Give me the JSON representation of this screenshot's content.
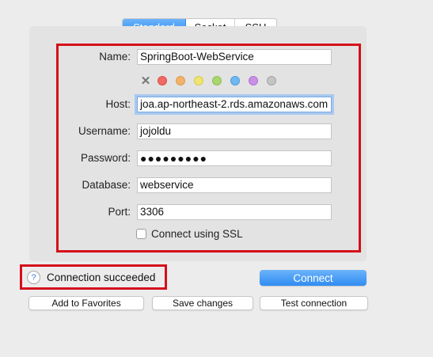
{
  "tabs": [
    {
      "label": "Standard",
      "active": true
    },
    {
      "label": "Socket",
      "active": false
    },
    {
      "label": "SSH",
      "active": false
    }
  ],
  "form": {
    "name": {
      "label": "Name:",
      "value": "SpringBoot-WebService"
    },
    "host": {
      "label": "Host:",
      "value": "joa.ap-northeast-2.rds.amazonaws.com"
    },
    "username": {
      "label": "Username:",
      "value": "jojoldu"
    },
    "password": {
      "label": "Password:",
      "value": "●●●●●●●●●"
    },
    "database": {
      "label": "Database:",
      "value": "webservice"
    },
    "port": {
      "label": "Port:",
      "value": "3306"
    },
    "ssl": {
      "label": "Connect using SSL",
      "checked": false
    }
  },
  "color_tags": {
    "clear_icon": "x-icon",
    "colors": [
      "#ee6a63",
      "#f3b269",
      "#f0e46f",
      "#a9d76e",
      "#6fb8f2",
      "#c990e6",
      "#c4c4c4"
    ],
    "borders": [
      "#d9514a",
      "#dc9a4f",
      "#d8c94f",
      "#8fbf55",
      "#4e9ddc",
      "#b173d1",
      "#a5a5a5"
    ]
  },
  "status": {
    "help_icon": "?",
    "text": "Connection succeeded"
  },
  "buttons": {
    "connect": "Connect",
    "add_favorites": "Add to Favorites",
    "save_changes": "Save changes",
    "test_connection": "Test connection"
  },
  "theme": {
    "accent": "#2f8cf2",
    "highlight_border": "#d40f1b"
  }
}
